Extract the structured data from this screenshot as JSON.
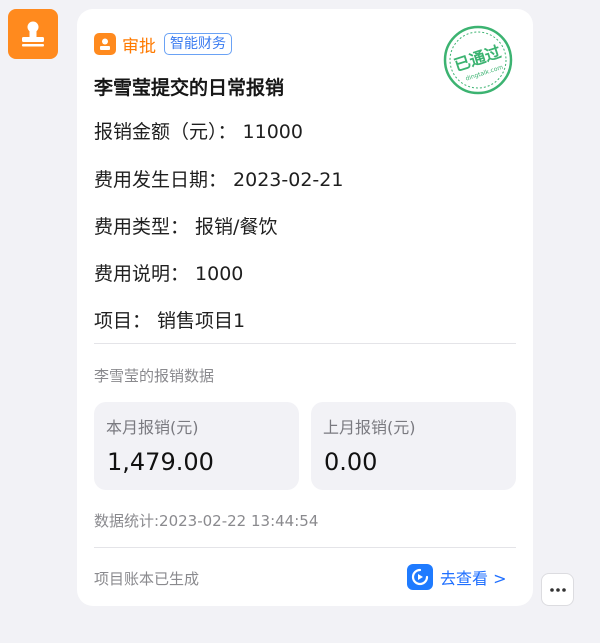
{
  "icons": {
    "avatar": "approval-stamp-icon",
    "header": "approval-icon",
    "goto": "dingtalk-icon",
    "more": "more-dots-icon"
  },
  "colors": {
    "accent_orange": "#ff8a1e",
    "tag_blue": "#3a7bf0",
    "stamp_green": "#3cb371",
    "link_blue": "#1f6fff"
  },
  "header": {
    "app_name": "审批",
    "tag": "智能财务"
  },
  "stamp": {
    "text": "已通过",
    "sub": "dingtalk.com"
  },
  "message": {
    "title": "李雪莹提交的日常报销",
    "fields": [
      "报销金额（元）：  11000",
      "费用发生日期：  2023-02-21",
      "费用类型：  报销/餐饮",
      "费用说明：  1000",
      "项目：  销售项目1"
    ]
  },
  "stats": {
    "section_title": "李雪莹的报销数据",
    "this_month": {
      "label": "本月报销(元)",
      "value": "1,479.00"
    },
    "last_month": {
      "label": "上月报销(元)",
      "value": "0.00"
    },
    "timestamp": "数据统计:2023-02-22 13:44:54"
  },
  "footer": {
    "text": "项目账本已生成",
    "link_label": "去查看 >"
  }
}
